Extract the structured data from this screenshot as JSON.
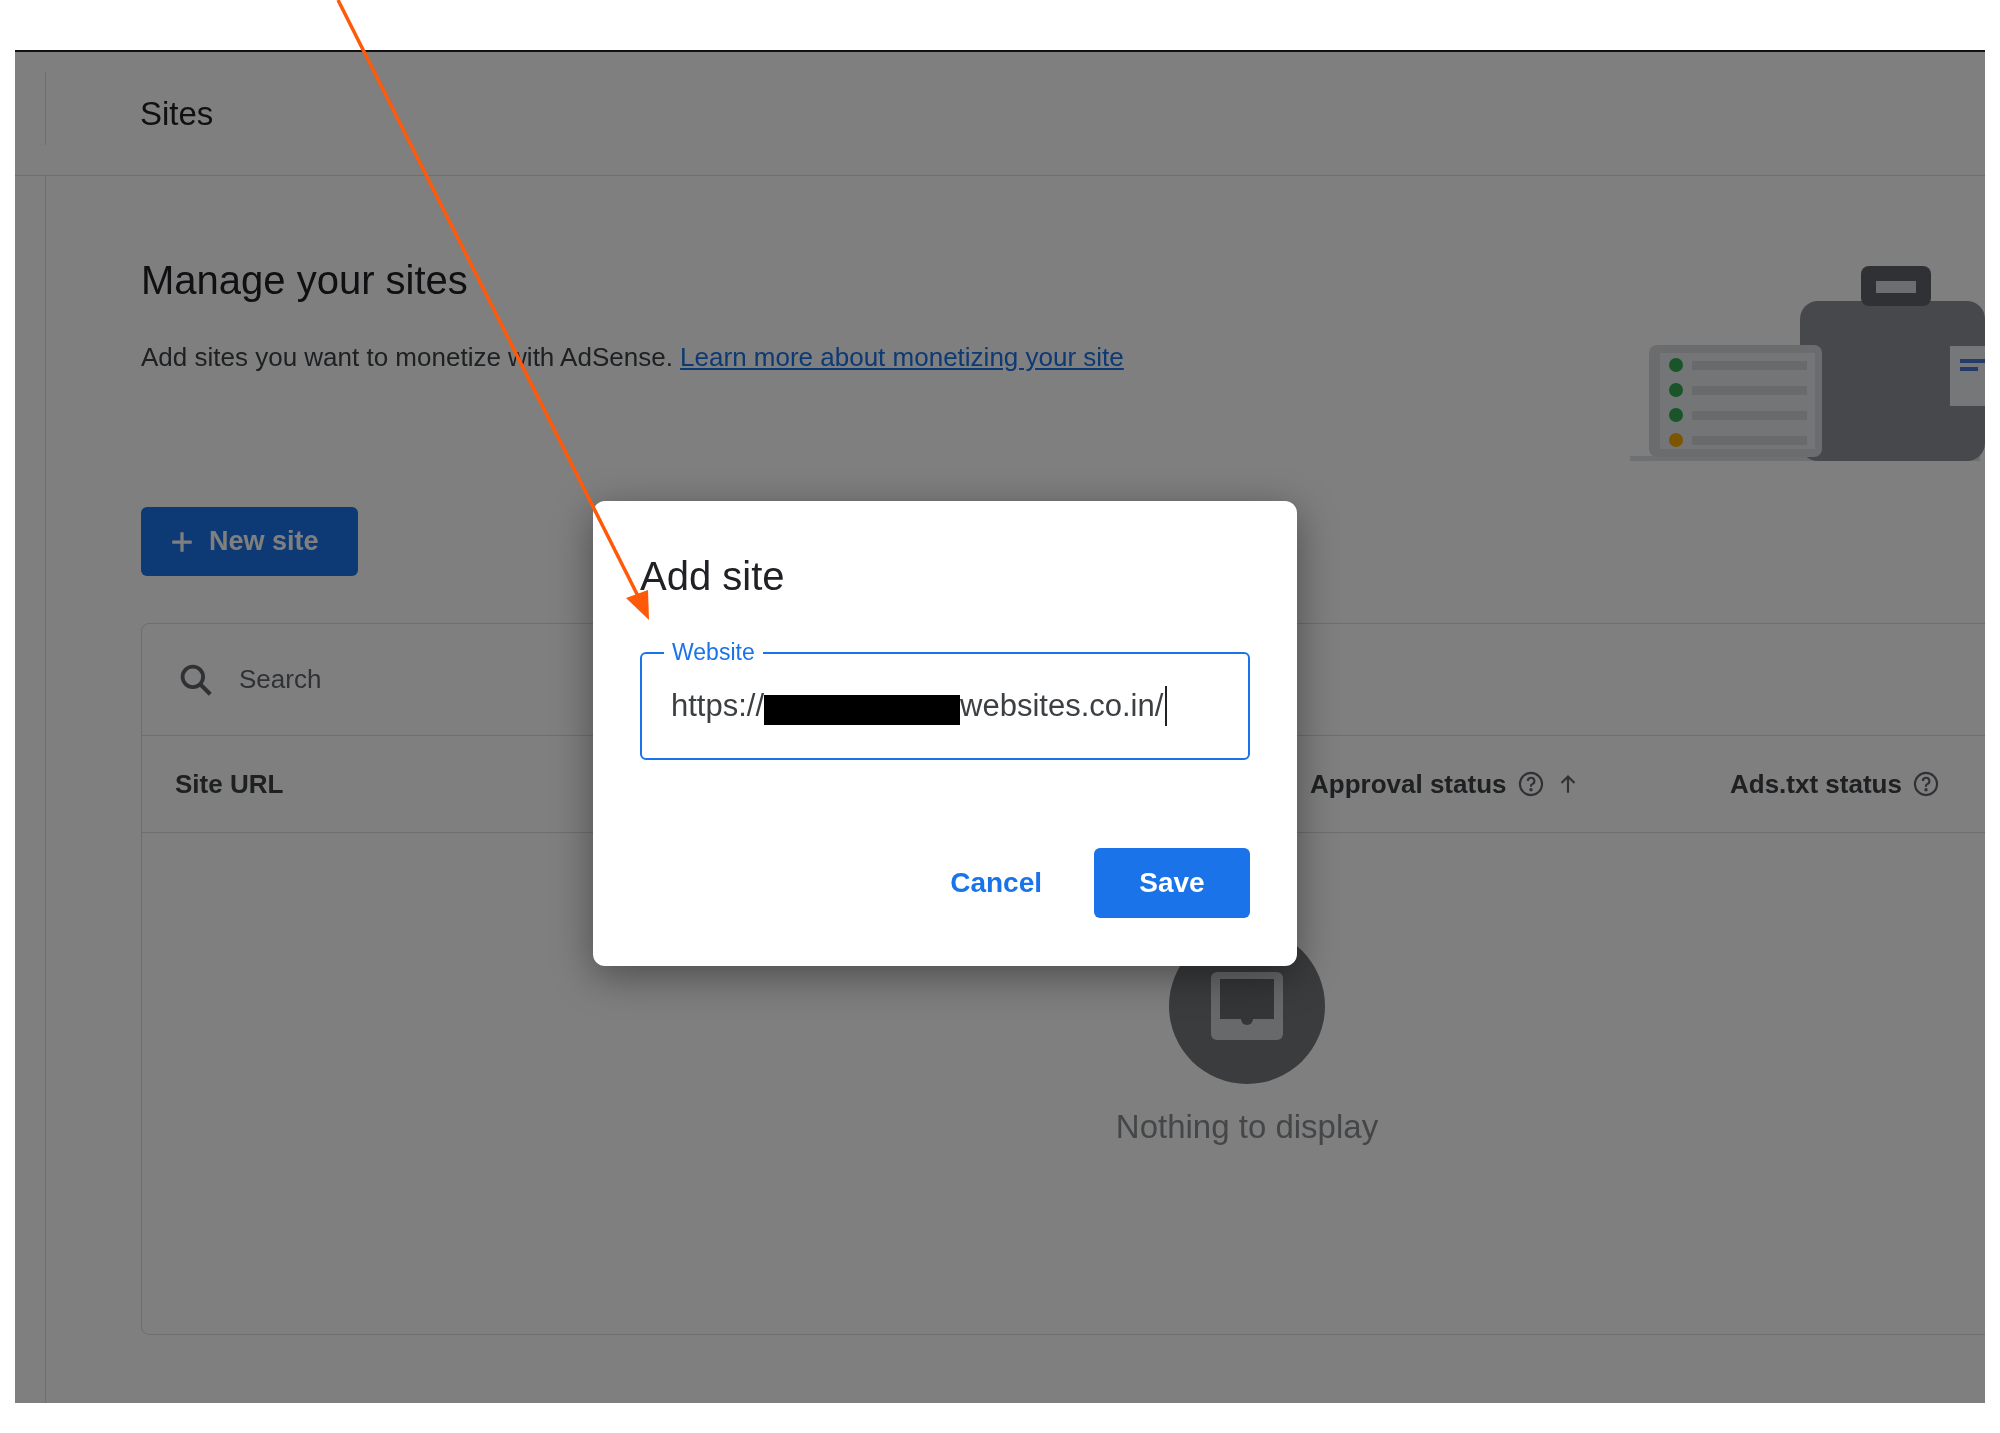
{
  "header": {
    "title": "Sites"
  },
  "intro": {
    "heading": "Manage your sites",
    "description": "Add sites you want to monetize with AdSense.",
    "link": "Learn more about monetizing your site"
  },
  "new_site_button": {
    "label": "New site"
  },
  "table": {
    "search": {
      "placeholder": "Search"
    },
    "columns": [
      {
        "label": "Site URL",
        "help": false,
        "sorted": false
      },
      {
        "label": "Approval status",
        "help": true,
        "sorted": true
      },
      {
        "label": "Ads.txt status",
        "help": true,
        "sorted": false
      }
    ],
    "empty_message": "Nothing to display"
  },
  "dialog": {
    "title": "Add site",
    "field": {
      "label": "Website",
      "value_start": "https://",
      "value_end": "websites.co.in/",
      "focused": true
    },
    "buttons": [
      {
        "label": "Cancel",
        "kind": "text"
      },
      {
        "label": "Save",
        "kind": "filled"
      }
    ]
  }
}
